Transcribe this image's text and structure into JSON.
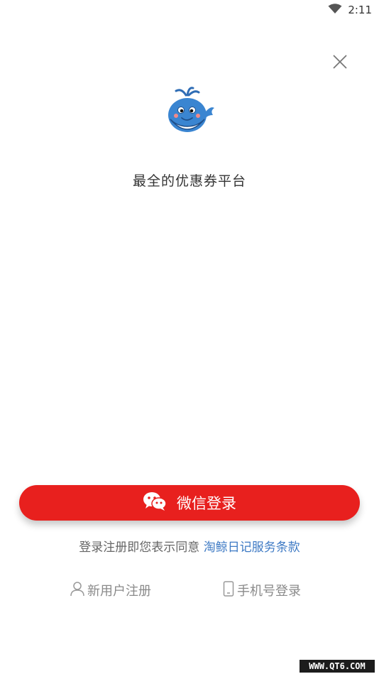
{
  "status_bar": {
    "time": "2:11",
    "wifi_icon": "wifi-icon"
  },
  "header": {
    "close_icon": "close-icon"
  },
  "brand": {
    "logo_icon": "whale-logo-icon",
    "slogan": "最全的优惠券平台"
  },
  "login": {
    "wechat_button_label": "微信登录",
    "wechat_icon": "wechat-icon",
    "accent_color": "#e8201e"
  },
  "terms": {
    "prefix": "登录注册即您表示同意 ",
    "link": "淘鲸日记服务条款",
    "link_color": "#3e7ac4"
  },
  "alternatives": {
    "register_label": "新用户注册",
    "register_icon": "person-icon",
    "phone_login_label": "手机号登录",
    "phone_icon": "phone-icon"
  },
  "watermark": "WWW.QT6.COM"
}
